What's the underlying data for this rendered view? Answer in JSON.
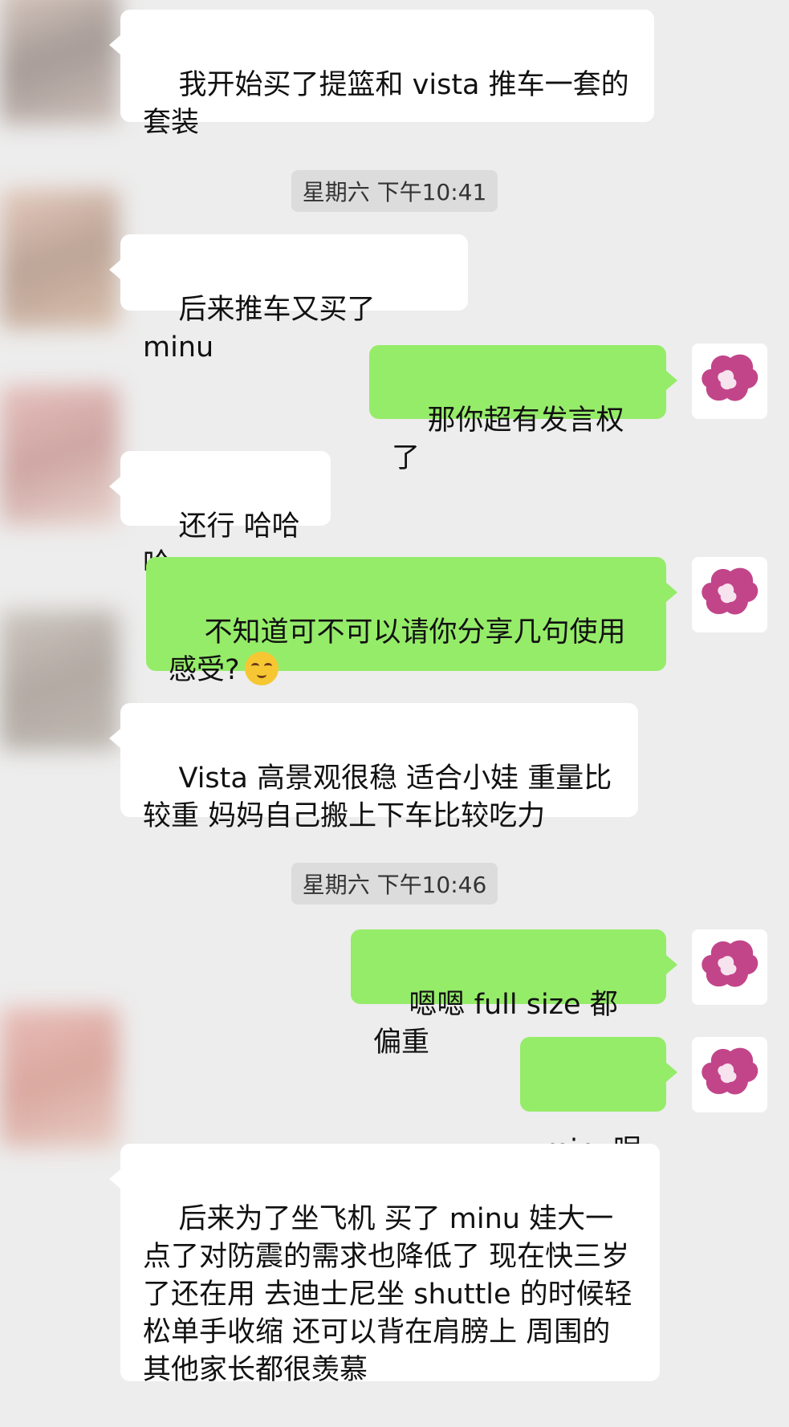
{
  "messages": [
    {
      "side": "in",
      "text": "我开始买了提篮和 vista 推车一套的套装"
    },
    {
      "side": "time",
      "text": "星期六 下午10:41"
    },
    {
      "side": "in",
      "text": "后来推车又买了 minu"
    },
    {
      "side": "out",
      "text": "那你超有发言权了"
    },
    {
      "side": "in",
      "text": "还行 哈哈哈"
    },
    {
      "side": "out",
      "text": "不知道可不可以请你分享几句使用感受?",
      "emoji": "smiling-face-emoji"
    },
    {
      "side": "in",
      "text": "Vista 高景观很稳 适合小娃 重量比较重 妈妈自己搬上下车比较吃力"
    },
    {
      "side": "time",
      "text": "星期六 下午10:46"
    },
    {
      "side": "out",
      "text": "嗯嗯 full size 都偏重"
    },
    {
      "side": "out",
      "text": "minu呢"
    },
    {
      "side": "in",
      "text": "后来为了坐飞机 买了 minu 娃大一点了对防震的需求也降低了 现在快三岁了还在用 去迪士尼坐 shuttle 的时候轻松单手收缩 还可以背在肩膀上 周围的其他家长都很羡慕"
    }
  ],
  "colors": {
    "background": "#ededed",
    "incoming_bubble": "#ffffff",
    "outgoing_bubble": "#95ec69",
    "avatar_accent": "#c2458a"
  },
  "icons": {
    "self_avatar": "heart-logo-icon",
    "contact_avatar": "blurred-avatar"
  }
}
